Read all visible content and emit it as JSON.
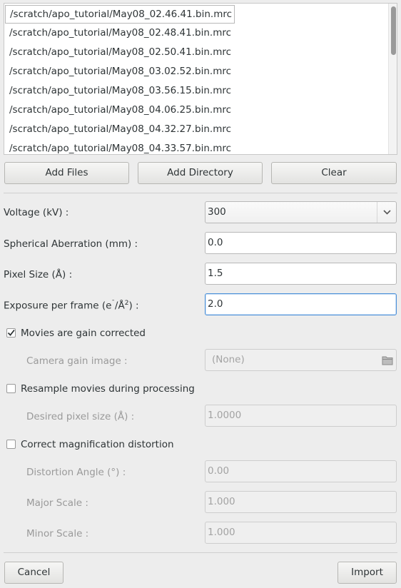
{
  "files": [
    "/scratch/apo_tutorial/May08_02.46.41.bin.mrc",
    "/scratch/apo_tutorial/May08_02.48.41.bin.mrc",
    "/scratch/apo_tutorial/May08_02.50.41.bin.mrc",
    "/scratch/apo_tutorial/May08_03.02.52.bin.mrc",
    "/scratch/apo_tutorial/May08_03.56.15.bin.mrc",
    "/scratch/apo_tutorial/May08_04.06.25.bin.mrc",
    "/scratch/apo_tutorial/May08_04.32.27.bin.mrc",
    "/scratch/apo_tutorial/May08_04.33.57.bin.mrc"
  ],
  "buttons": {
    "add_files": "Add Files",
    "add_directory": "Add Directory",
    "clear": "Clear",
    "cancel": "Cancel",
    "import": "Import"
  },
  "form": {
    "voltage_label": "Voltage (kV) :",
    "voltage_value": "300",
    "spherical_label": "Spherical Aberration (mm) :",
    "spherical_value": "0.0",
    "pixel_label": "Pixel Size (Å) :",
    "pixel_value": "1.5",
    "exposure_label_pre": "Exposure per frame (e",
    "exposure_label_sup1": "¯",
    "exposure_label_mid": "/Å",
    "exposure_label_sup2": "2",
    "exposure_label_post": ") :",
    "exposure_value": "2.0",
    "gain_corrected_label": "Movies are gain corrected",
    "gain_corrected_checked": true,
    "camera_gain_label": "Camera gain image :",
    "camera_gain_value": "(None)",
    "resample_label": "Resample movies during processing",
    "resample_checked": false,
    "desired_pixel_label": "Desired pixel size (Å) :",
    "desired_pixel_value": "1.0000",
    "correct_mag_label": "Correct magnification distortion",
    "correct_mag_checked": false,
    "distortion_angle_label": "Distortion Angle (°) :",
    "distortion_angle_value": "0.00",
    "major_scale_label": "Major Scale  :",
    "major_scale_value": "1.000",
    "minor_scale_label": "Minor Scale  :",
    "minor_scale_value": "1.000"
  },
  "colors": {
    "background": "#ededed",
    "focus_border": "#4a90d9",
    "disabled_text": "#9a9a9a"
  }
}
